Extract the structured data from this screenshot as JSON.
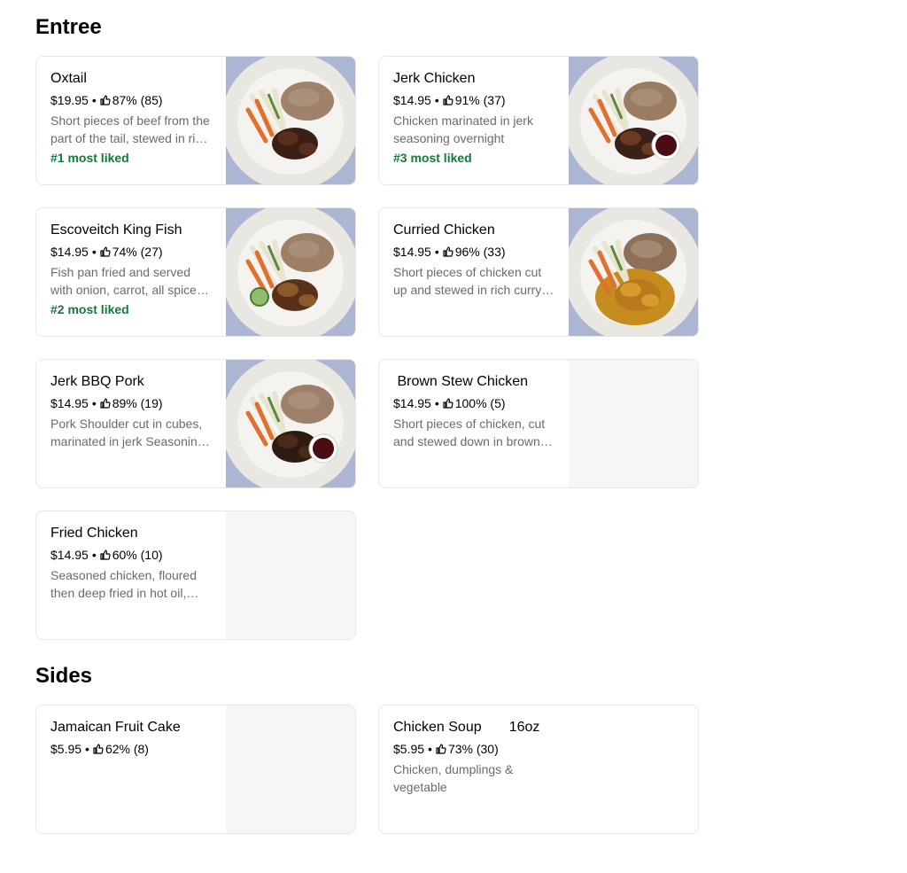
{
  "sections": {
    "entree": {
      "title": "Entree",
      "items": [
        {
          "name": "Oxtail",
          "price": "$19.95",
          "rating": "87% (85)",
          "desc": "Short pieces of beef from the part of the tail, stewed in rich gravy",
          "badge": "#1 most liked",
          "photo": "oxtail"
        },
        {
          "name": "Jerk Chicken",
          "price": "$14.95",
          "rating": "91% (37)",
          "desc": "Chicken marinated in jerk seasoning overnight",
          "badge": "#3 most liked",
          "photo": "jerk-chicken"
        },
        {
          "name": "Escoveitch King Fish",
          "price": "$14.95",
          "rating": "74% (27)",
          "desc": "Fish pan fried and served with onion, carrot, all spice and vinegar",
          "badge": "#2 most liked",
          "photo": "king-fish"
        },
        {
          "name": "Curried Chicken",
          "price": "$14.95",
          "rating": "96% (33)",
          "desc": "Short pieces of chicken cut up and stewed in rich curry sauce",
          "badge": "",
          "photo": "curried-chicken"
        },
        {
          "name": "Jerk BBQ Pork",
          "price": "$14.95",
          "rating": "89% (19)",
          "desc": "Pork Shoulder cut in cubes, marinated in jerk Seasoning overnight",
          "badge": "",
          "photo": "jerk-pork"
        },
        {
          "name": " Brown Stew Chicken",
          "price": "$14.95",
          "rating": "100% (5)",
          "desc": "Short pieces of chicken, cut and stewed down in brown sauce",
          "badge": "",
          "photo": ""
        },
        {
          "name": "Fried Chicken",
          "price": "$14.95",
          "rating": "60% (10)",
          "desc": "Seasoned chicken, floured then deep fried in hot oil, crispy",
          "badge": "",
          "photo": ""
        }
      ]
    },
    "sides": {
      "title": "Sides",
      "items": [
        {
          "name": "Jamaican Fruit Cake",
          "price": "$5.95",
          "rating": "62% (8)",
          "desc": "",
          "badge": "",
          "photo": ""
        },
        {
          "name": "Chicken Soup       16oz",
          "price": "$5.95",
          "rating": "73% (30)",
          "desc": "Chicken, dumplings & vegetable",
          "badge": "",
          "photo": "none"
        }
      ]
    }
  },
  "separator": "•",
  "icons": {
    "rating": "thumbs-up-icon"
  },
  "colors": {
    "badge": "#117a3d",
    "description": "#6b6b6b",
    "placeholder": "#f6f6f6"
  }
}
